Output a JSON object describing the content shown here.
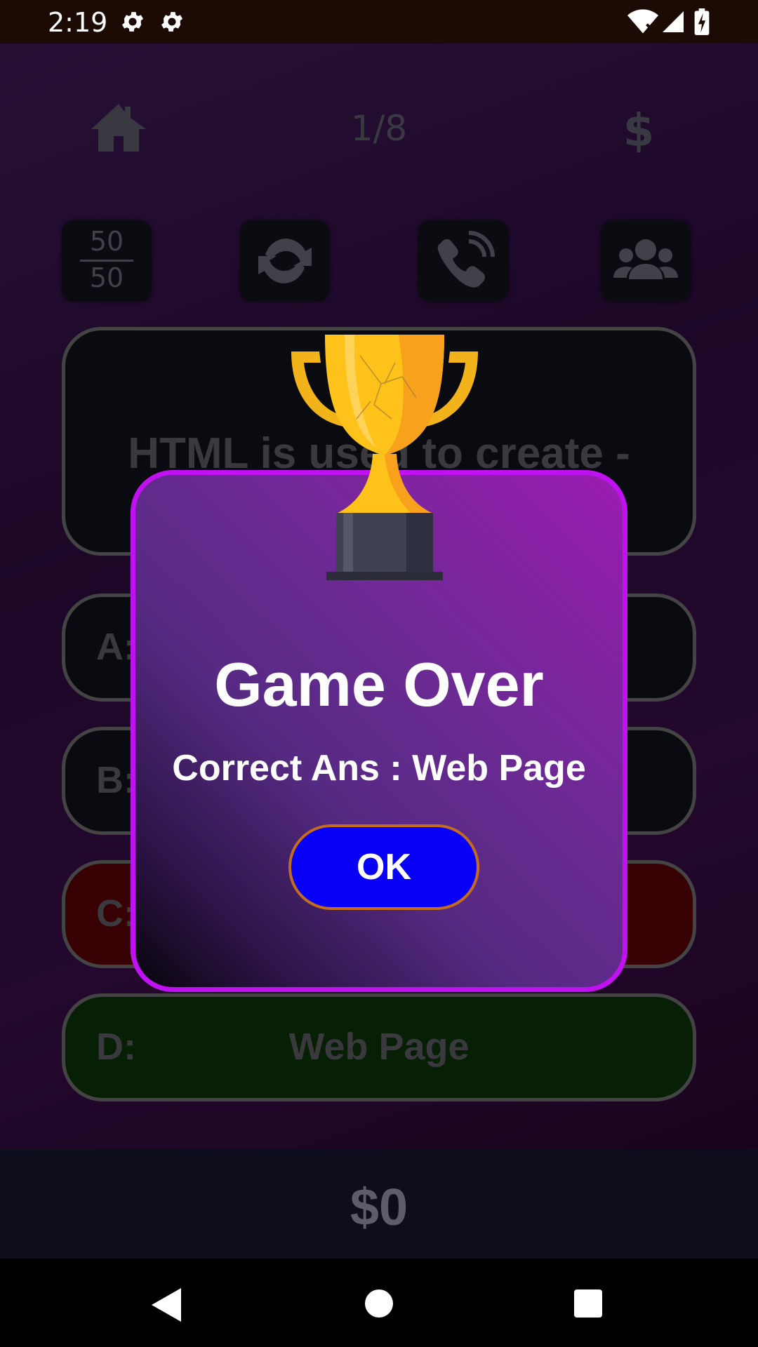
{
  "status_bar": {
    "time": "2:19",
    "icons": [
      "settings-gear-icon",
      "settings-gear-icon",
      "wifi-icon",
      "signal-icon",
      "battery-charging-icon"
    ]
  },
  "header": {
    "home_icon": "home-icon",
    "progress": "1/8",
    "currency_symbol": "$"
  },
  "lifelines": {
    "fifty_top": "50",
    "fifty_bottom": "50",
    "swap_icon": "refresh-icon",
    "phone_icon": "phone-call-icon",
    "audience_icon": "audience-group-icon"
  },
  "question": {
    "text": "HTML is used to create -"
  },
  "answers": [
    {
      "letter": "A:",
      "text": "",
      "state": "normal"
    },
    {
      "letter": "B:",
      "text": "",
      "state": "normal"
    },
    {
      "letter": "C:",
      "text": "",
      "state": "wrong",
      "color": "#5a0006"
    },
    {
      "letter": "D:",
      "text": "Web Page",
      "state": "correct",
      "color": "#0c3207"
    }
  ],
  "prize": {
    "amount": "$0"
  },
  "dialog": {
    "icon": "trophy-icon",
    "title": "Game Over",
    "message": "Correct Ans : Web Page",
    "ok_label": "OK",
    "border_color": "#c012f0",
    "button_color": "#0800f6"
  },
  "nav": {
    "back_icon": "back-triangle-icon",
    "home_icon": "home-circle-icon",
    "recents_icon": "recents-square-icon"
  }
}
